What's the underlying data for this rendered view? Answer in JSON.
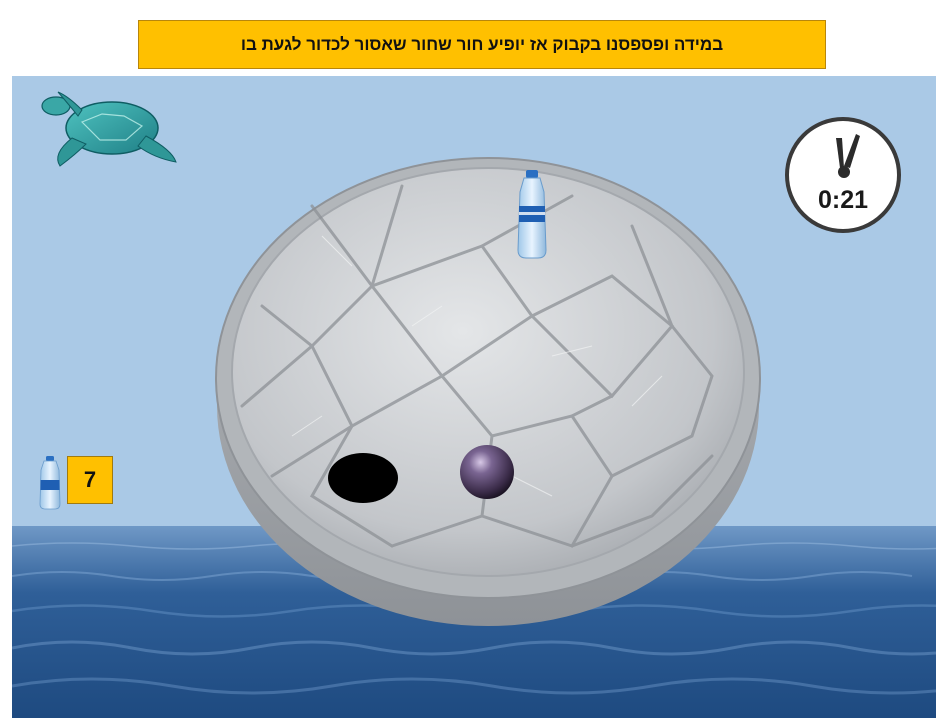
{
  "instruction": {
    "text": "במידה ופספסנו בקבוק אז  יופיע חור שחור שאסור לכדור לגעת בו"
  },
  "hud": {
    "bottle_count": "7",
    "timer": "0:21",
    "timer_icon": "clock-icon",
    "counter_icon": "water-bottle-icon"
  },
  "scene": {
    "mascot_icon": "sea-turtle-icon",
    "platform": "round-stone-platform",
    "items": [
      "water-bottle",
      "black-hole",
      "player-ball"
    ]
  },
  "colors": {
    "banner_bg": "#ffc000",
    "sky": "#aac9e6",
    "sea": "#2a5d9a",
    "stone": "#c9cccf",
    "ball": "#4a3a5a",
    "hole": "#000000"
  }
}
